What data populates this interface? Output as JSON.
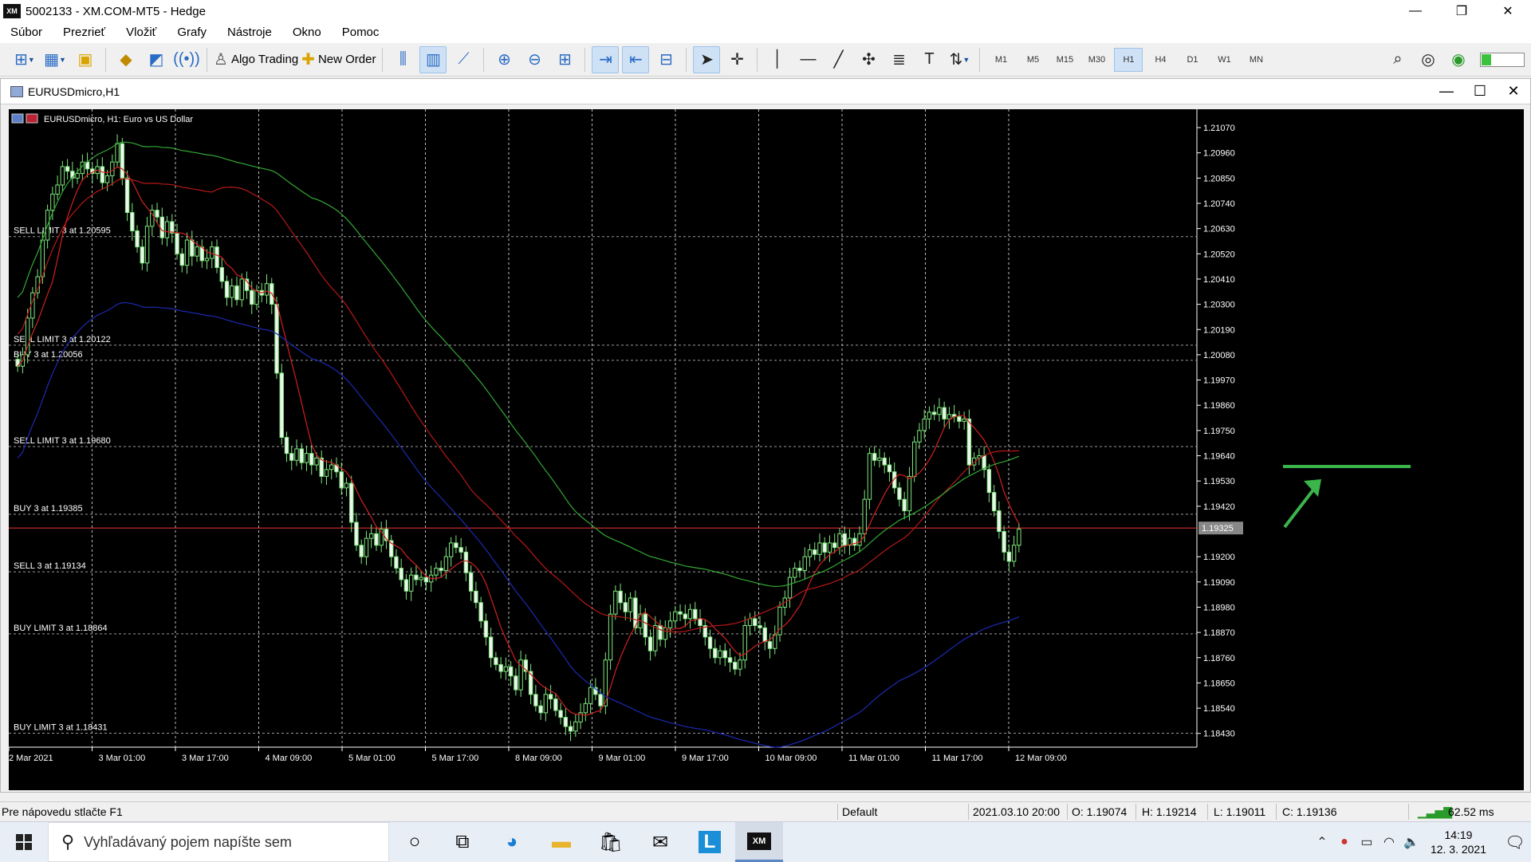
{
  "window": {
    "logo": "XM",
    "title": "5002133 - XM.COM-MT5 - Hedge",
    "minimize": "—",
    "restore": "❐",
    "close": "✕"
  },
  "menu": [
    "Súbor",
    "Prezrieť",
    "Vložiť",
    "Grafy",
    "Nástroje",
    "Okno",
    "Pomoc"
  ],
  "toolbar": {
    "algo_trading": "Algo Trading",
    "new_order": "New Order",
    "timeframes": [
      "M1",
      "M5",
      "M15",
      "M30",
      "H1",
      "H4",
      "D1",
      "W1",
      "MN"
    ],
    "active_timeframe": "H1"
  },
  "chart_window": {
    "title": "EURUSDmicro,H1",
    "header": "EURUSDmicro, H1:  Euro vs US Dollar"
  },
  "chart_data": {
    "type": "candlestick",
    "symbol": "EURUSDmicro",
    "timeframe": "H1",
    "ylim": [
      1.1837,
      1.2115
    ],
    "price_ticks": [
      1.2107,
      1.2096,
      1.2085,
      1.2074,
      1.2063,
      1.2052,
      1.2041,
      1.203,
      1.2019,
      1.2008,
      1.1997,
      1.1986,
      1.1975,
      1.1964,
      1.1953,
      1.1942,
      1.192,
      1.1909,
      1.1898,
      1.1887,
      1.1876,
      1.1865,
      1.1854,
      1.1843
    ],
    "time_ticks": [
      "2 Mar 2021",
      "3 Mar 01:00",
      "3 Mar 17:00",
      "4 Mar 09:00",
      "5 Mar 01:00",
      "5 Mar 17:00",
      "8 Mar 09:00",
      "9 Mar 01:00",
      "9 Mar 17:00",
      "10 Mar 09:00",
      "11 Mar 01:00",
      "11 Mar 17:00",
      "12 Mar 09:00"
    ],
    "current_price": 1.19325,
    "current_price_label": "1.19325",
    "order_lines": [
      {
        "label": "SELL LIMIT 3 at 1.20595",
        "price": 1.20595
      },
      {
        "label": "SELL LIMIT 3 at 1.20122",
        "price": 1.20122
      },
      {
        "label": "BUY 3 at 1.20056",
        "price": 1.20056
      },
      {
        "label": "SELL LIMIT 3 at 1.19680",
        "price": 1.1968
      },
      {
        "label": "BUY 3 at 1.19385",
        "price": 1.19385
      },
      {
        "label": "SELL 3 at 1.19134",
        "price": 1.19134
      },
      {
        "label": "BUY LIMIT 3 at 1.18864",
        "price": 1.18864
      },
      {
        "label": "BUY LIMIT 3 at 1.18431",
        "price": 1.18431
      }
    ],
    "close_series": [
      1.2003,
      1.2008,
      1.2024,
      1.2035,
      1.2042,
      1.2058,
      1.2071,
      1.2078,
      1.2082,
      1.209,
      1.2088,
      1.2085,
      1.2087,
      1.2092,
      1.2089,
      1.2087,
      1.209,
      1.2083,
      1.2086,
      1.2092,
      1.21,
      1.2085,
      1.207,
      1.2062,
      1.2055,
      1.2048,
      1.2064,
      1.2071,
      1.2068,
      1.2059,
      1.2066,
      1.2061,
      1.2052,
      1.2047,
      1.2058,
      1.2051,
      1.2055,
      1.2049,
      1.205,
      1.2055,
      1.2046,
      1.204,
      1.2033,
      1.2038,
      1.2032,
      1.2041,
      1.2036,
      1.203,
      1.2036,
      1.2034,
      1.2039,
      1.203,
      1.2,
      1.1972,
      1.1965,
      1.1962,
      1.1967,
      1.1961,
      1.1965,
      1.196,
      1.1963,
      1.1955,
      1.1958,
      1.196,
      1.1957,
      1.195,
      1.1952,
      1.1935,
      1.1925,
      1.192,
      1.1928,
      1.193,
      1.1925,
      1.1932,
      1.1927,
      1.192,
      1.1915,
      1.191,
      1.1905,
      1.1912,
      1.191,
      1.1911,
      1.1909,
      1.1912,
      1.1915,
      1.1914,
      1.192,
      1.1926,
      1.1924,
      1.1922,
      1.1913,
      1.1905,
      1.19,
      1.1892,
      1.1885,
      1.1876,
      1.1873,
      1.187,
      1.1872,
      1.1868,
      1.1862,
      1.1875,
      1.187,
      1.186,
      1.1855,
      1.1852,
      1.186,
      1.1858,
      1.1853,
      1.185,
      1.1846,
      1.1844,
      1.1848,
      1.1852,
      1.1856,
      1.1863,
      1.186,
      1.1855,
      1.1875,
      1.1895,
      1.1905,
      1.19,
      1.1896,
      1.1902,
      1.1889,
      1.1895,
      1.1885,
      1.1879,
      1.189,
      1.1884,
      1.1889,
      1.1892,
      1.1896,
      1.1895,
      1.1893,
      1.1897,
      1.1893,
      1.189,
      1.1885,
      1.188,
      1.1876,
      1.1879,
      1.1876,
      1.1874,
      1.1871,
      1.1875,
      1.189,
      1.1893,
      1.189,
      1.1889,
      1.1883,
      1.188,
      1.1886,
      1.1898,
      1.1902,
      1.1911,
      1.1915,
      1.1914,
      1.192,
      1.1923,
      1.1921,
      1.1926,
      1.1922,
      1.1926,
      1.1924,
      1.193,
      1.1925,
      1.1928,
      1.1925,
      1.193,
      1.1945,
      1.1965,
      1.1962,
      1.1963,
      1.196,
      1.1957,
      1.195,
      1.1945,
      1.194,
      1.1955,
      1.197,
      1.1975,
      1.198,
      1.1983,
      1.1982,
      1.1985,
      1.198,
      1.1982,
      1.1981,
      1.1979,
      1.198,
      1.196,
      1.1963,
      1.1964,
      1.1958,
      1.1948,
      1.194,
      1.1931,
      1.1922,
      1.1918,
      1.1925,
      1.1932
    ]
  },
  "status": {
    "help": "Pre nápovedu stlačte F1",
    "profile": "Default",
    "datetime": "2021.03.10 20:00",
    "open": "O: 1.19074",
    "high": "H: 1.19214",
    "low": "L: 1.19011",
    "close": "C: 1.19136",
    "ping": "62.52 ms"
  },
  "taskbar": {
    "search_placeholder": "Vyhľadávaný pojem napíšte sem",
    "xm_app": "XM",
    "clock_time": "14:19",
    "clock_date": "12. 3. 2021"
  }
}
